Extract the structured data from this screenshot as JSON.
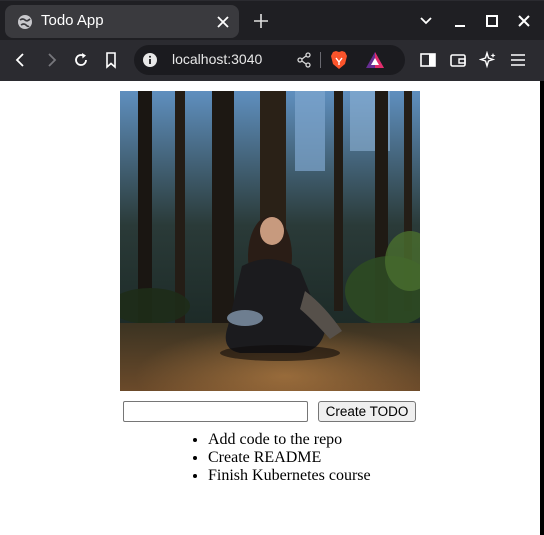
{
  "browser": {
    "tab_title": "Todo App",
    "url": "localhost:3040",
    "icons": {
      "tab_favicon": "globe-icon",
      "tab_close": "close-icon",
      "new_tab": "plus-icon",
      "window_menu": "chevron-down-icon",
      "minimize": "minimize-icon",
      "maximize": "maximize-icon",
      "close_window": "close-icon",
      "back": "back-arrow-icon",
      "forward": "forward-arrow-icon",
      "reload": "reload-icon",
      "bookmark": "bookmark-icon",
      "site_info": "info-icon",
      "share": "share-icon",
      "brave_shields": "brave-lion-icon",
      "brave_rewards": "rewards-triangle-icon",
      "sidebar": "sidebar-icon",
      "wallet": "wallet-icon",
      "leo": "sparkle-icon",
      "menu": "hamburger-menu-icon"
    },
    "colors": {
      "chrome_bg": "#1f1f23",
      "toolbar_bg": "#2b2b30",
      "brave_orange": "#fb542b"
    }
  },
  "page": {
    "image_alt": "",
    "create_button_label": "Create TODO",
    "input_value": "",
    "todos": [
      "Add code to the repo",
      "Create README",
      "Finish Kubernetes course"
    ]
  }
}
